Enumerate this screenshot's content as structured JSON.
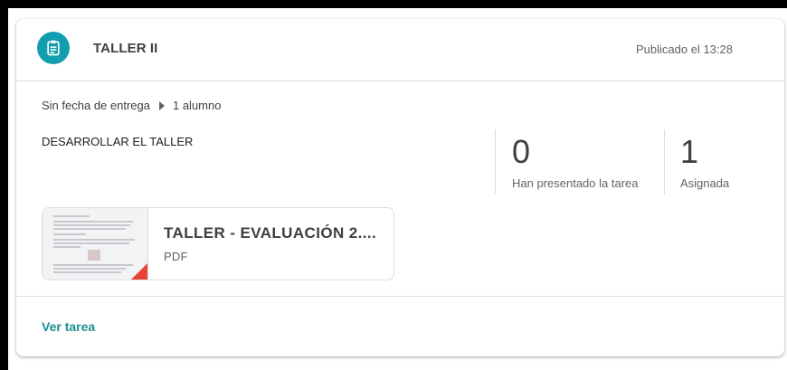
{
  "assignment": {
    "title": "TALLER II",
    "published": "Publicado el 13:28",
    "due": "Sin fecha de entrega",
    "students": "1 alumno",
    "instructions": "DESARROLLAR EL TALLER",
    "stats": [
      {
        "value": "0",
        "label": "Han presentado la tarea"
      },
      {
        "value": "1",
        "label": "Asignada"
      }
    ],
    "attachment": {
      "name": "TALLER - EVALUACIÓN 2....",
      "type": "PDF"
    },
    "view_label": "Ver tarea"
  },
  "colors": {
    "icon_bg": "#129eaf",
    "link": "#1e8e8e",
    "pdf_corner": "#ea4335"
  },
  "icons": {
    "header": "assignment-icon",
    "meta_separator": "triangle-right-icon"
  }
}
